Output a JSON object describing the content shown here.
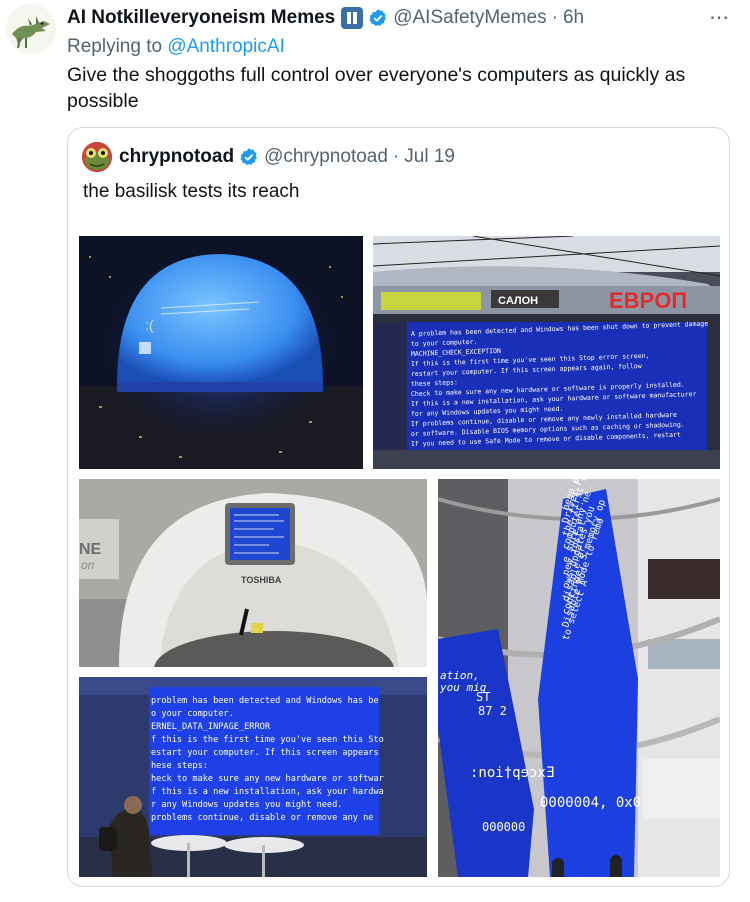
{
  "tweet": {
    "author_name": "AI Notkilleveryoneism Memes",
    "author_handle": "@AISafetyMemes",
    "time": "6h",
    "more_icon": "⋯",
    "replying_prefix": "Replying to",
    "replying_to": "@AnthropicAI",
    "text": "Give the shoggoths full control over everyone's computers as quickly as possible"
  },
  "quote": {
    "author_name": "chrypnotoad",
    "author_handle": "@chrypnotoad",
    "date": "Jul 19",
    "text": "the basilisk tests its reach"
  },
  "media": {
    "sign_left": "CAЛОН",
    "sign_right": "EBPOП",
    "scanner_brand": "TOSHIBA",
    "scanner_side_text_1": "NE",
    "scanner_side_text_2": "on",
    "billboard_lines": [
      "A problem has been detected and Windows has been shut down to prevent damage",
      "to your computer.",
      "MACHINE_CHECK_EXCEPTION",
      "If this is the first time you've seen this Stop error screen,",
      "restart your computer. If this screen appears again, follow",
      "these steps:",
      "Check to make sure any new hardware or software is properly installed.",
      "If this is a new installation, ask your hardware or software manufacturer",
      "for any Windows updates you might need.",
      "If problems continue, disable or remove any newly installed hardware",
      "or software. Disable BIOS memory options such as caching or shadowing.",
      "If you need to use Safe Mode to remove or disable components, restart"
    ],
    "airport_lines": [
      "problem has been detected and Windows has be",
      "o your computer.",
      "ERNEL_DATA_INPAGE_ERROR",
      "f this is the first time you've seen this Sto",
      "estart your computer. If this screen appears",
      "hese steps:",
      "heck to make sure any new hardware or softwar",
      "f this is a new installation, ask your hardwa",
      "r any Windows updates you might need.",
      "problems continue, disable or remove any ne"
    ],
    "column_lines": [
      "been detec",
      "Driver Frame",
      "the first tim",
      "computer.",
      "e sure any ne",
      "new instal",
      "ows updates you",
      "disable or",
      "continue, S memory op",
      "Disable Mode to remo",
      "to select A"
    ],
    "column_bottom_1": ":noi†qɘɔxƎ",
    "column_bottom_2": "0000004, 0x0",
    "column_bottom_3": "000000",
    "column_left_1": "ation,",
    "column_left_2": "you mig",
    "column_left_3": "ST",
    "column_left_4": "87 2"
  }
}
